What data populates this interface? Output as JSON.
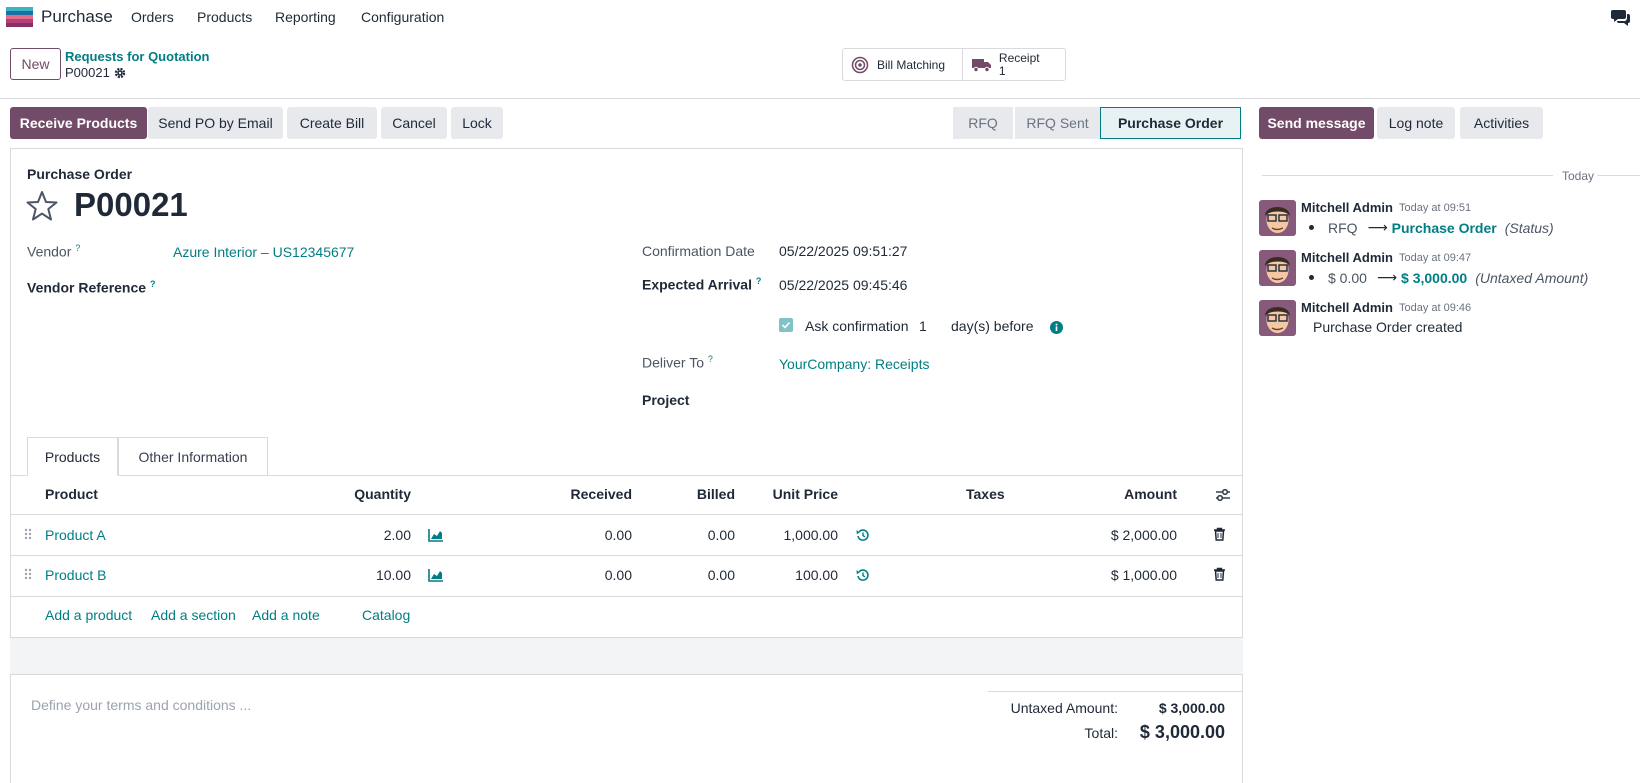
{
  "nav": {
    "app_name": "Purchase",
    "menu": [
      "Orders",
      "Products",
      "Reporting",
      "Configuration"
    ]
  },
  "control": {
    "new_label": "New",
    "breadcrumb": "Requests for Quotation",
    "record": "P00021",
    "smart_buttons": [
      {
        "label": "Bill Matching",
        "icon": "target-icon"
      },
      {
        "label": "Receipt",
        "count": "1",
        "icon": "truck-icon"
      }
    ]
  },
  "actions": [
    "Receive Products",
    "Send PO by Email",
    "Create Bill",
    "Cancel",
    "Lock"
  ],
  "status": [
    "RFQ",
    "RFQ Sent",
    "Purchase Order"
  ],
  "status_active": "Purchase Order",
  "form": {
    "section_label": "Purchase Order",
    "title": "P00021",
    "vendor_label": "Vendor",
    "vendor_value": "Azure Interior – US12345677",
    "vendor_ref_label": "Vendor Reference",
    "confirmation_label": "Confirmation Date",
    "confirmation_value": "05/22/2025 09:51:27",
    "arrival_label": "Expected Arrival",
    "arrival_value": "05/22/2025 09:45:46",
    "ask_label": "Ask confirmation",
    "ask_days": "1",
    "ask_suffix": "day(s) before",
    "deliver_label": "Deliver To",
    "deliver_value": "YourCompany: Receipts",
    "project_label": "Project",
    "help_mark": "?"
  },
  "tabs": [
    "Products",
    "Other Information"
  ],
  "table": {
    "headers": {
      "product": "Product",
      "quantity": "Quantity",
      "received": "Received",
      "billed": "Billed",
      "unit_price": "Unit Price",
      "taxes": "Taxes",
      "amount": "Amount"
    },
    "rows": [
      {
        "product": "Product A",
        "quantity": "2.00",
        "received": "0.00",
        "billed": "0.00",
        "unit_price": "1,000.00",
        "taxes": "",
        "amount": "$ 2,000.00"
      },
      {
        "product": "Product B",
        "quantity": "10.00",
        "received": "0.00",
        "billed": "0.00",
        "unit_price": "100.00",
        "taxes": "",
        "amount": "$ 1,000.00"
      }
    ],
    "add_links": [
      "Add a product",
      "Add a section",
      "Add a note",
      "Catalog"
    ]
  },
  "footer": {
    "terms_placeholder": "Define your terms and conditions ...",
    "untaxed_label": "Untaxed Amount:",
    "untaxed_value": "$ 3,000.00",
    "total_label": "Total:",
    "total_value": "$ 3,000.00"
  },
  "chatter": {
    "buttons": [
      "Send message",
      "Log note",
      "Activities"
    ],
    "date_separator": "Today",
    "messages": [
      {
        "author": "Mitchell Admin",
        "time": "Today at 09:51",
        "old": "RFQ",
        "new": "Purchase Order",
        "field": "(Status)"
      },
      {
        "author": "Mitchell Admin",
        "time": "Today at 09:47",
        "old": "$ 0.00",
        "new": "$ 3,000.00",
        "field": "(Untaxed Amount)"
      },
      {
        "author": "Mitchell Admin",
        "time": "Today at 09:46",
        "body": "Purchase Order created"
      }
    ]
  },
  "colors": {
    "brand": "#714b67",
    "link": "#017e84",
    "border": "#d8dadd",
    "button_bg": "#e7e9ed"
  }
}
